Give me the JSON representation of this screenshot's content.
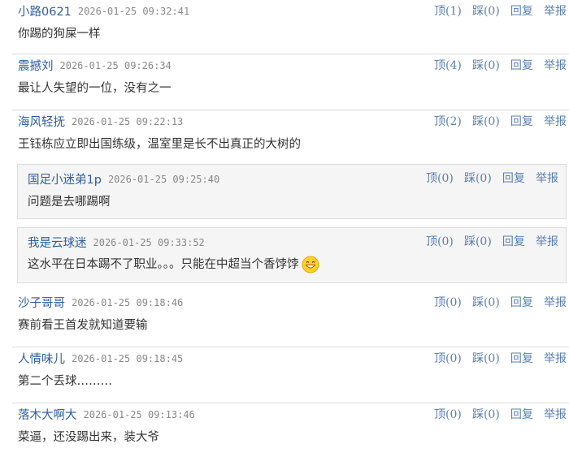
{
  "actions": {
    "up": "顶",
    "down": "踩",
    "reply": "回复",
    "report": "举报"
  },
  "comments": [
    {
      "user": "小路0621",
      "time": "2026-01-25 09:32:41",
      "up": "(1)",
      "down": "(0)",
      "text": "你踢的狗屎一样"
    },
    {
      "user": "震撼刘",
      "time": "2026-01-25 09:26:34",
      "up": "(4)",
      "down": "(0)",
      "text": "最让人失望的一位，没有之一"
    },
    {
      "user": "海风轻抚",
      "time": "2026-01-25 09:22:13",
      "up": "(2)",
      "down": "(0)",
      "text": "王钰栋应立即出国练级，温室里是长不出真正的大树的"
    },
    {
      "user": "沙子哥哥",
      "time": "2026-01-25 09:18:46",
      "up": "(0)",
      "down": "(0)",
      "text": "赛前看王首发就知道要输"
    },
    {
      "user": "人情味儿",
      "time": "2026-01-25 09:18:45",
      "up": "(0)",
      "down": "(0)",
      "text": "第二个丢球………"
    },
    {
      "user": "落木大啊大",
      "time": "2026-01-25 09:13:46",
      "up": "(0)",
      "down": "(0)",
      "text": "菜逼，还没踢出来，装大爷"
    }
  ],
  "replies": [
    {
      "user": "国足小迷弟1p",
      "time": "2026-01-25 09:25:40",
      "up": "(0)",
      "down": "(0)",
      "text": "问题是去哪踢啊"
    },
    {
      "user": "我是云球迷",
      "time": "2026-01-25 09:33:52",
      "up": "(0)",
      "down": "(0)",
      "text": "这水平在日本踢不了职业。。。只能在中超当个香饽饽",
      "emoji": "grinning-sweat-emoji"
    }
  ]
}
